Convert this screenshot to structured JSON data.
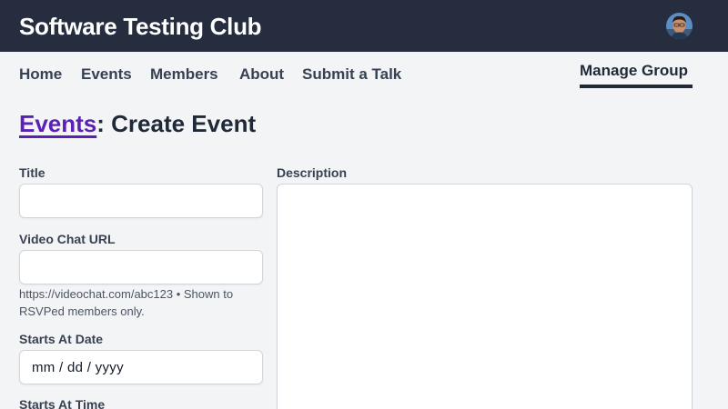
{
  "header": {
    "site_title": "Software Testing Club"
  },
  "nav": {
    "items": [
      {
        "label": "Home"
      },
      {
        "label": "Events"
      },
      {
        "label": "Members"
      },
      {
        "label": "About"
      },
      {
        "label": "Submit a Talk"
      }
    ],
    "manage_group": "Manage Group"
  },
  "page": {
    "breadcrumb_link": "Events",
    "title": ": Create Event"
  },
  "form": {
    "title_label": "Title",
    "title_value": "",
    "video_chat_label": "Video Chat URL",
    "video_chat_value": "",
    "video_chat_hint": "https://videochat.com/abc123 • Shown to RSVPed members only.",
    "starts_at_date_label": "Starts At Date",
    "starts_at_date_value": "mm / dd / yyyy",
    "starts_at_time_label": "Starts At Time",
    "description_label": "Description",
    "description_value": ""
  },
  "colors": {
    "header_bg": "#252d3f",
    "link_accent": "#5b21b6",
    "page_bg": "#f3f4f6"
  }
}
